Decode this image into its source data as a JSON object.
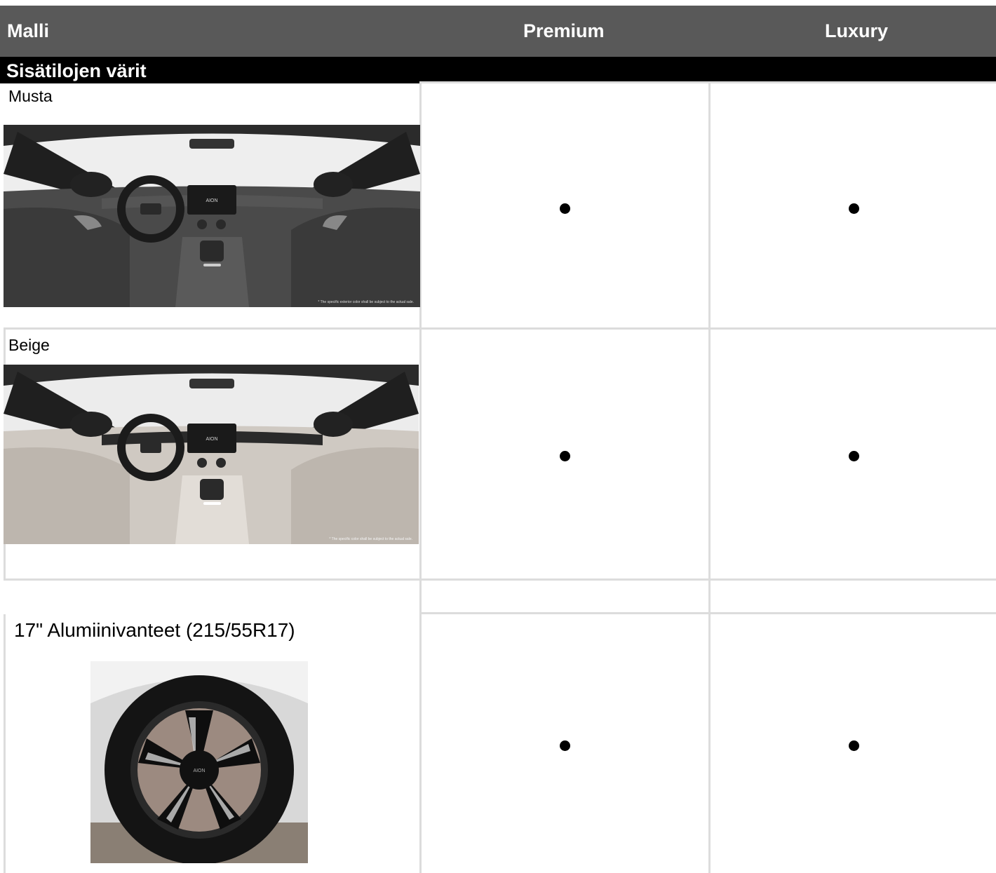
{
  "header": {
    "col_model": "Malli",
    "col_premium": "Premium",
    "col_luxury": "Luxury"
  },
  "section": {
    "title": "Sisätilojen värit"
  },
  "rows": [
    {
      "label": "Musta",
      "image_icon": "car-interior-black-photo",
      "premium": "●",
      "luxury": "●",
      "caption": "* The specific exterior color shall be subject to the actual sale."
    },
    {
      "label": "Beige",
      "image_icon": "car-interior-beige-photo",
      "premium": "●",
      "luxury": "●",
      "caption": "* The specific color shall be subject to the actual sale."
    },
    {
      "label": "17\" Alumiinivanteet (215/55R17)",
      "image_icon": "alloy-wheel-photo",
      "premium": "●",
      "luxury": "●"
    }
  ],
  "brand_text": "AION",
  "colors": {
    "header_bg": "#595959",
    "section_bg": "#000000",
    "grid": "#dcdcdc",
    "black_interior": "#3a3a3a",
    "beige_interior": "#cfc9c2"
  }
}
